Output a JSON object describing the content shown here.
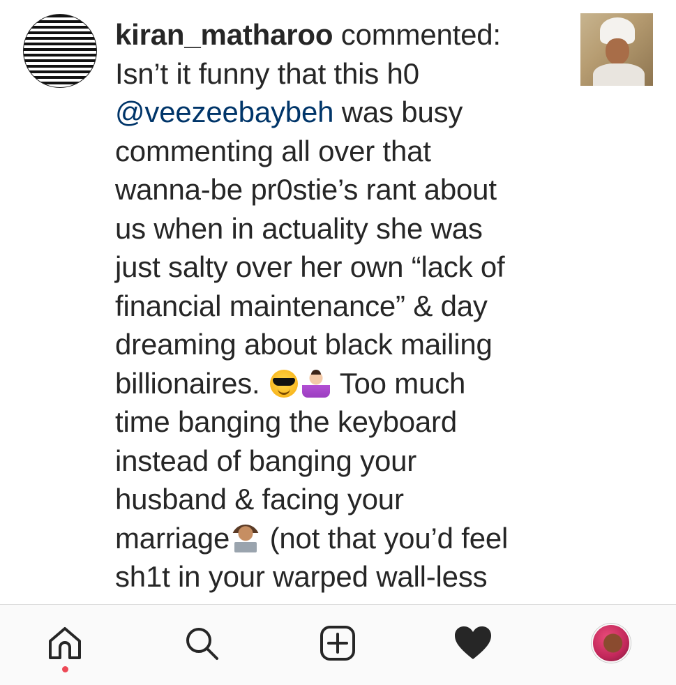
{
  "comment": {
    "username": "kiran_matharoo",
    "action": " commented:",
    "lines": [
      "Isn’t it funny that this h0",
      "@veezeebaybeh",
      " was busy",
      "commenting all over that",
      "wanna-be pr0stie’s rant about",
      "us when in actuality she was",
      "just salty over her own “lack of",
      "financial maintenance” & day",
      "dreaming about black mailing",
      "billionaires.",
      " Too much",
      "time banging the keyboard",
      "instead of banging your",
      "husband & facing your",
      "marriage",
      " (not that you’d feel",
      "sh1t in your warped wall-less"
    ],
    "emojis": [
      "smiling-face-with-sunglasses-emoji",
      "person-shrugging-emoji",
      "technologist-emoji"
    ]
  },
  "tabbar": {
    "tabs": [
      "home-icon",
      "search-icon",
      "add-icon",
      "heart-icon",
      "profile-avatar"
    ],
    "notification_dot_color": "#ed4956"
  },
  "colors": {
    "text": "#262626",
    "mention": "#003569",
    "tabbar_bg": "#fafafa"
  }
}
